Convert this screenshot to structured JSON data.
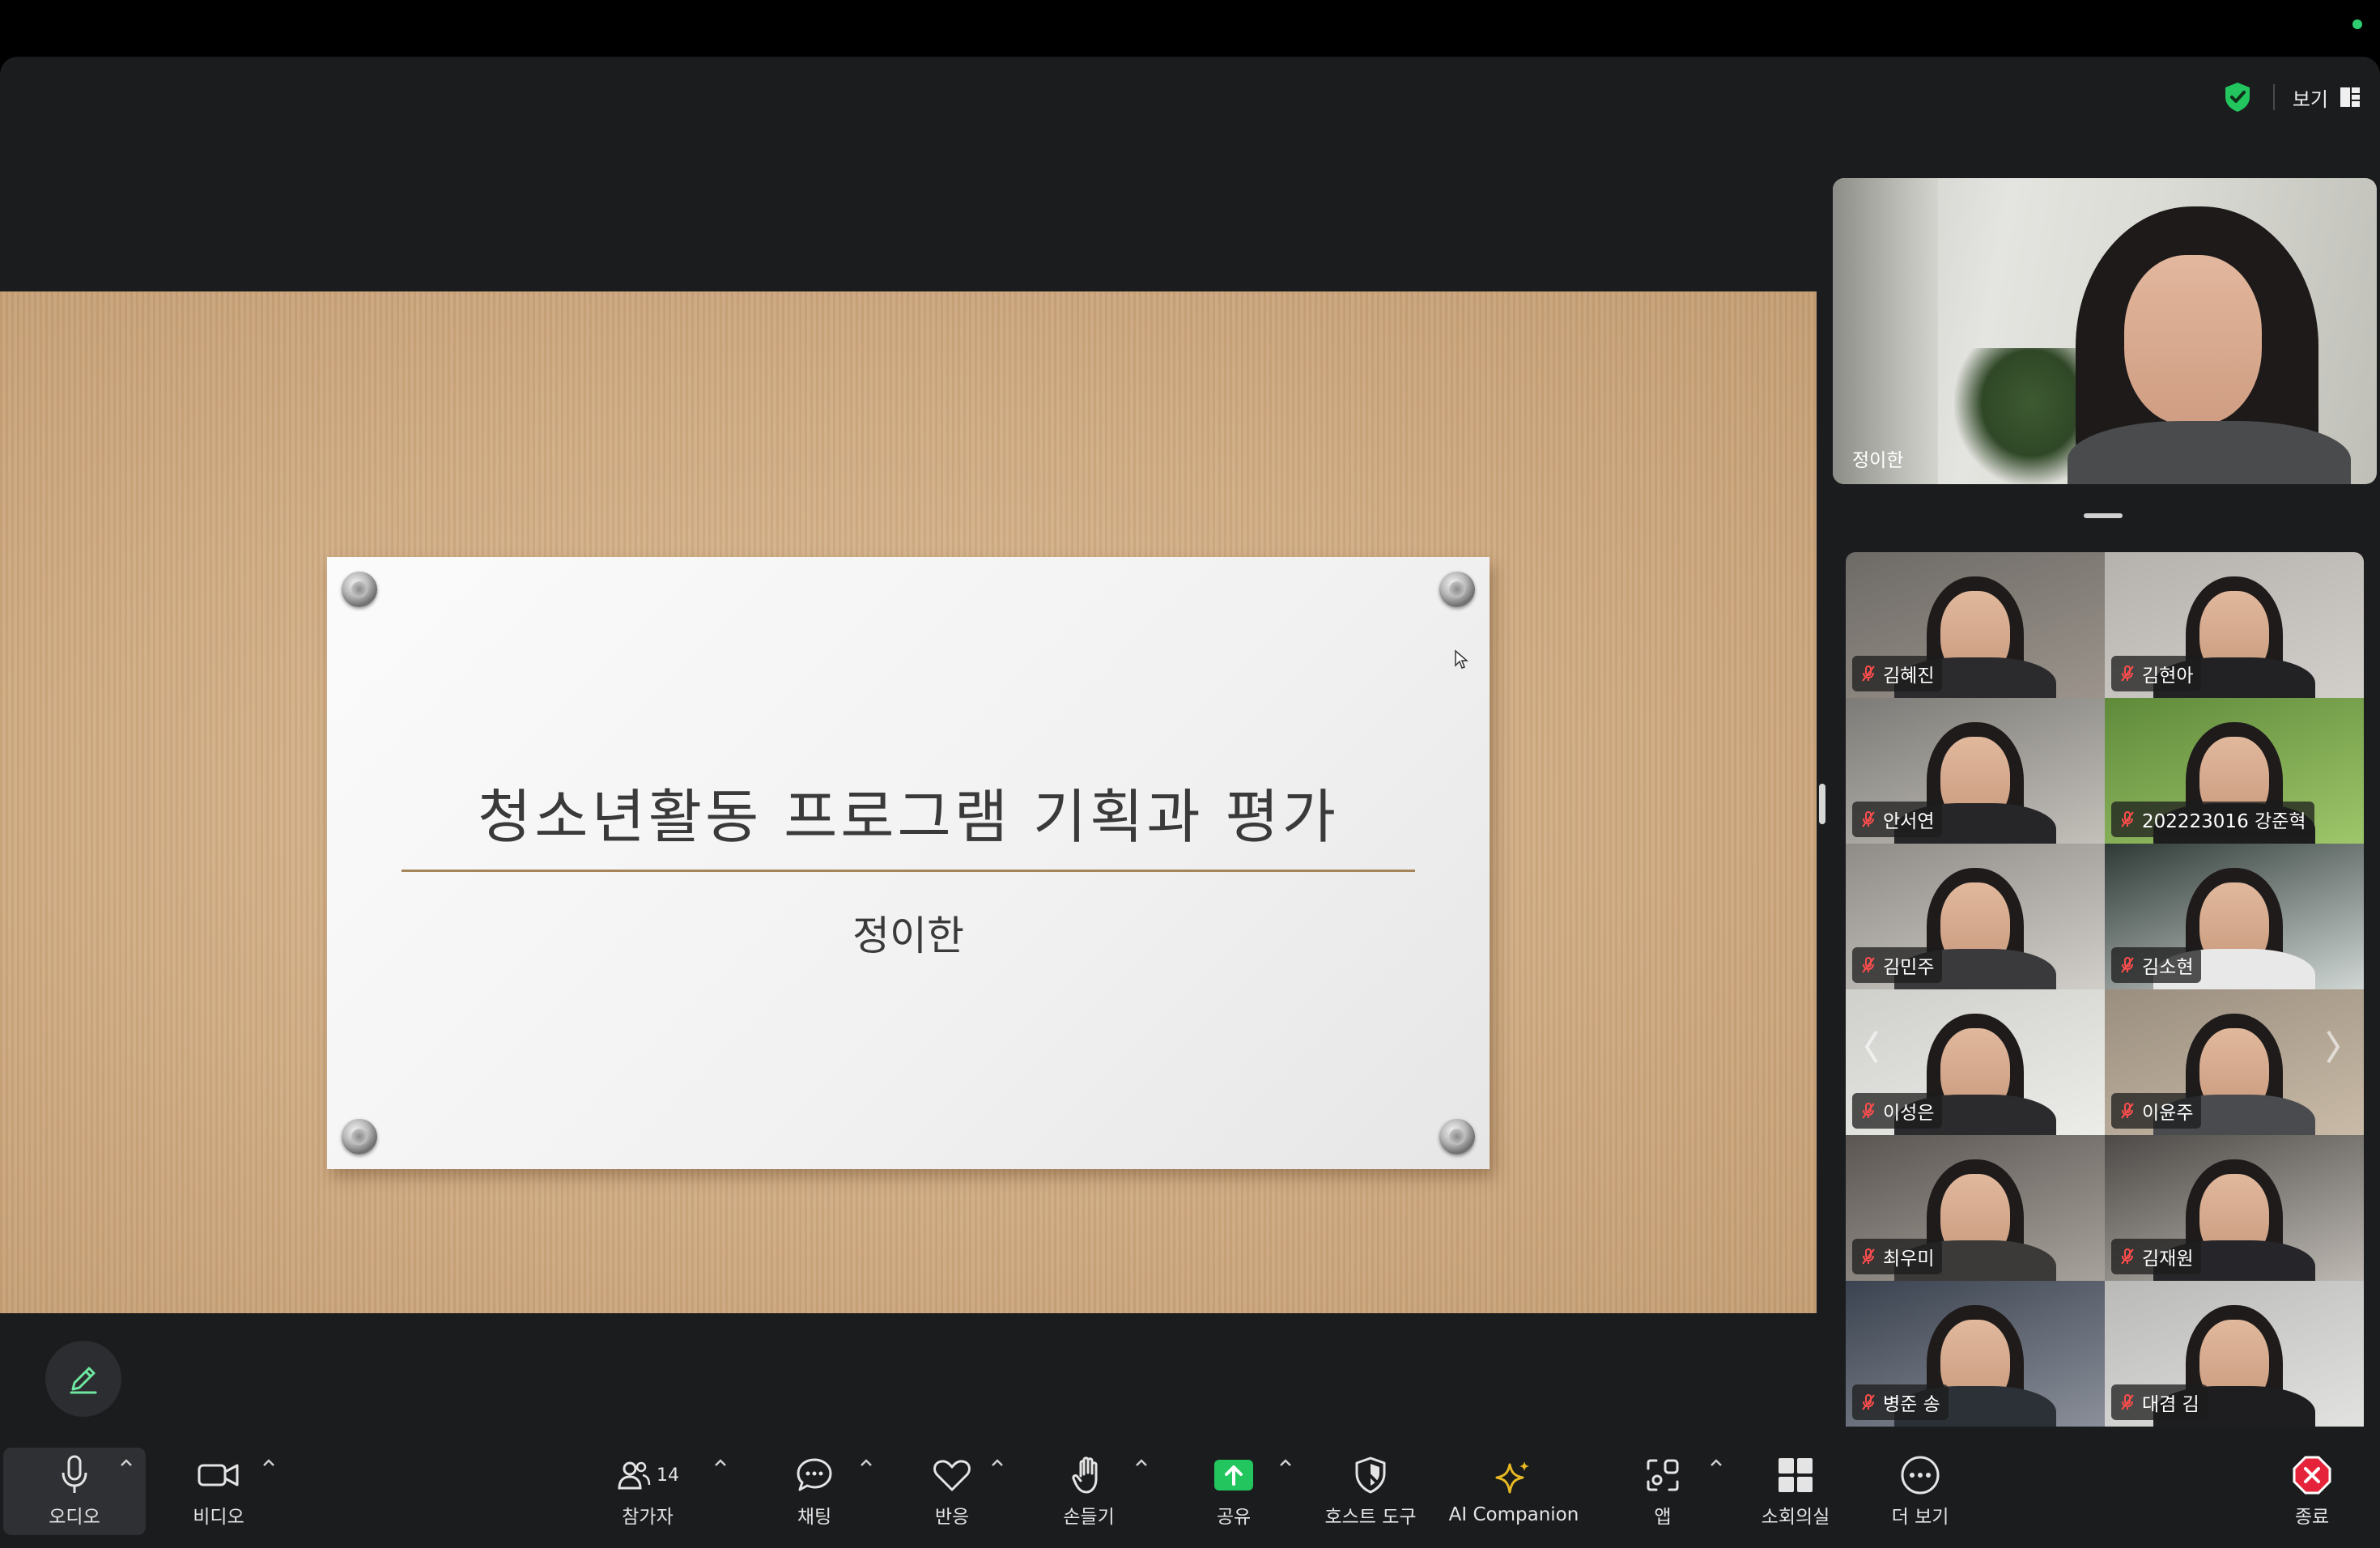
{
  "top_bar": {
    "view_label": "보기"
  },
  "slide": {
    "title": "청소년활동 프로그램 기획과 평가",
    "subtitle": "정이한"
  },
  "speaker": {
    "name": "정이한"
  },
  "participants": [
    {
      "name": "김혜진"
    },
    {
      "name": "김현아"
    },
    {
      "name": "안서연"
    },
    {
      "name": "202223016 강준혁"
    },
    {
      "name": "김민주"
    },
    {
      "name": "김소현"
    },
    {
      "name": "이성은"
    },
    {
      "name": "이윤주"
    },
    {
      "name": "최우미"
    },
    {
      "name": "김재원"
    },
    {
      "name": "병준 송"
    },
    {
      "name": "대겸 김"
    }
  ],
  "toolbar": {
    "audio": "오디오",
    "video": "비디오",
    "participants": "참가자",
    "participants_count": "14",
    "chat": "채팅",
    "reactions": "반응",
    "raise_hand": "손들기",
    "share": "공유",
    "host_tools": "호스트 도구",
    "ai_companion": "AI Companion",
    "apps": "앱",
    "breakout": "소회의실",
    "more": "더 보기",
    "end": "종료"
  },
  "colors": {
    "accent_green": "#22c55e",
    "end_red": "#e5243b",
    "ai_gold": "#e8b923"
  }
}
